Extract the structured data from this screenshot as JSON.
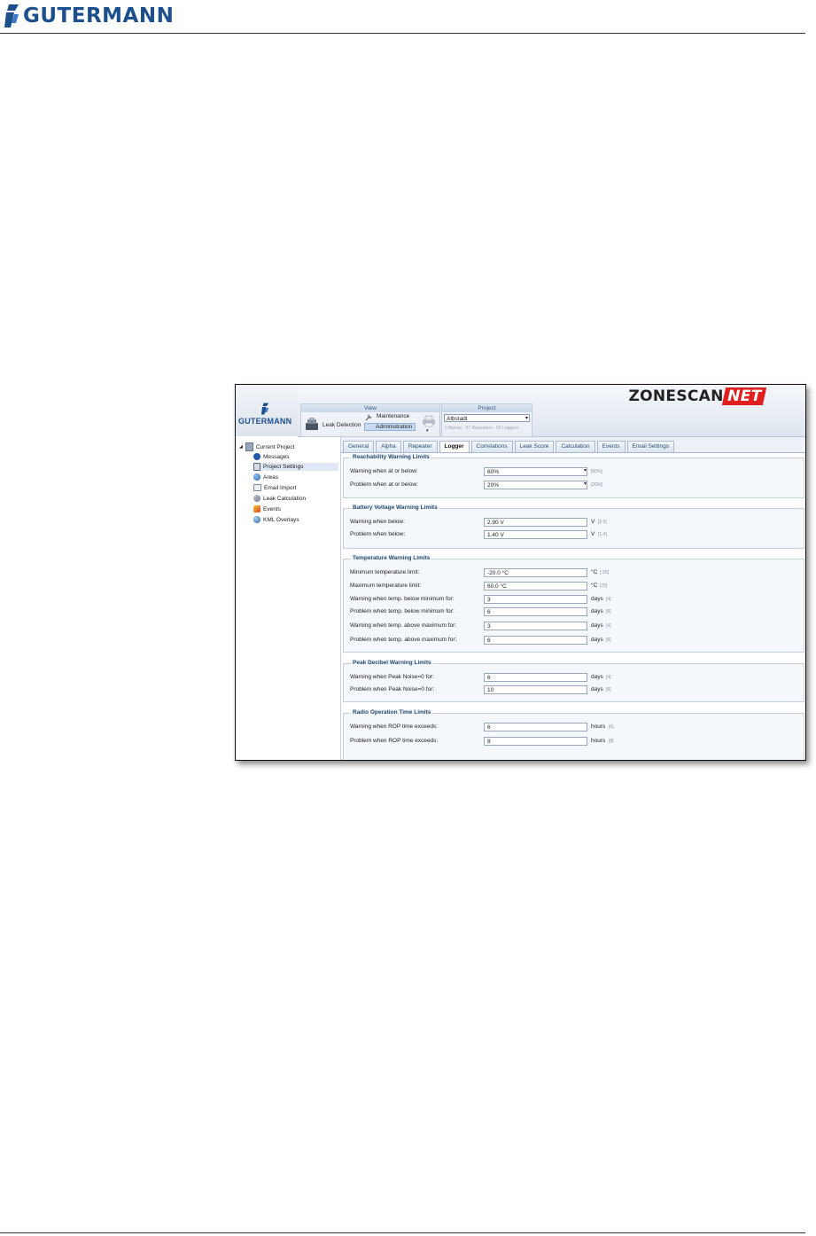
{
  "page": {
    "brand": "GUTERMANN"
  },
  "app": {
    "logo_text": "GUTERMANN",
    "product_logo_main": "ZONESCAN",
    "product_logo_accent": "NET",
    "ribbon": {
      "view_title": "View",
      "leak_detection": "Leak Detection",
      "maintenance": "Maintenance",
      "administration": "Administration",
      "project_title": "Project",
      "project_selected": "Albstadt",
      "project_summary": "2 Alphas - 57 Repeaters - 93 Loggers"
    },
    "tree": {
      "root": "Current Project",
      "items": [
        "Messages",
        "Project Settings",
        "Areas",
        "Email Import",
        "Leak Calculation",
        "Events",
        "KML Overlays"
      ]
    },
    "tabs": [
      "General",
      "Alpha",
      "Repeater",
      "Logger",
      "Correlations",
      "Leak Score",
      "Calculation",
      "Events",
      "Email Settings"
    ],
    "active_tab": "Logger",
    "sections": {
      "reach": {
        "title": "Reachability Warning Limits",
        "rows": [
          {
            "label": "Warning when at or below:",
            "value": "60%",
            "unit": "",
            "default": "[60%]"
          },
          {
            "label": "Problem when at or below:",
            "value": "20%",
            "unit": "",
            "default": "[20%]"
          }
        ]
      },
      "battery": {
        "title": "Battery Voltage Warning Limits",
        "rows": [
          {
            "label": "Warning when below:",
            "value": "2.90 V",
            "unit": "V",
            "default": "[2.9]"
          },
          {
            "label": "Problem when below:",
            "value": "1.40 V",
            "unit": "V",
            "default": "[1.4]"
          }
        ]
      },
      "temp": {
        "title": "Temperature Warning Limits",
        "rows": [
          {
            "label": "Minimum temperature limit:",
            "value": "-20.0 °C",
            "unit": "°C",
            "default": "[-30]"
          },
          {
            "label": "Maximum temperature limit:",
            "value": "60.0 °C",
            "unit": "°C",
            "default": "[70]"
          },
          {
            "label": "Warning when temp. below minimum for:",
            "value": "3",
            "unit": "days",
            "default": "[4]"
          },
          {
            "label": "Problem when temp. below minimum for:",
            "value": "6",
            "unit": "days",
            "default": "[8]"
          },
          {
            "label": "Warning when temp. above maximum for:",
            "value": "3",
            "unit": "days",
            "default": "[4]"
          },
          {
            "label": "Problem when temp. above maximum for:",
            "value": "6",
            "unit": "days",
            "default": "[8]"
          }
        ]
      },
      "peak": {
        "title": "Peak Decibel Warning Limits",
        "rows": [
          {
            "label": "Warning when Peak Noise=0 for:",
            "value": "6",
            "unit": "days",
            "default": "[4]"
          },
          {
            "label": "Problem when Peak Noise=0 for:",
            "value": "10",
            "unit": "days",
            "default": "[8]"
          }
        ]
      },
      "radio": {
        "title": "Radio Operation Time Limits",
        "rows": [
          {
            "label": "Warning when ROP time exceeds:",
            "value": "6",
            "unit": "hours",
            "default": "[6]"
          },
          {
            "label": "Problem when ROP time exceeds:",
            "value": "8",
            "unit": "hours",
            "default": "[8]"
          }
        ]
      }
    }
  },
  "colors": {
    "brand_blue": "#1d4f8c",
    "net_red": "#e02020",
    "panel_bg": "#f4f7fb"
  }
}
